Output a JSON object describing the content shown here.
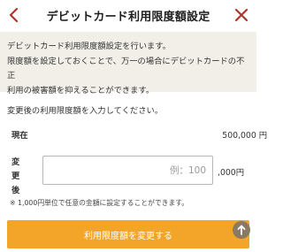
{
  "header": {
    "title": "デビットカード利用限度額設定",
    "back_icon": "chevron-left-icon",
    "close_icon": "close-icon",
    "accent_color": "#b3322b"
  },
  "intro": {
    "line1": "デビットカード利用限度額設定を行います。",
    "line2": "限度額を設定しておくことで、万一の場合にデビットカードの不正",
    "line3": "利用の被害額を抑えることができます。"
  },
  "instruction": "変更後の利用限度額を入力してください。",
  "current": {
    "label": "現在",
    "value": "500,000 円"
  },
  "change": {
    "label": "変更後",
    "placeholder": "例：100",
    "unit": ",000円"
  },
  "note": "※ 1,000円単位で任意の金額に設定することができます。",
  "submit": {
    "label": "利用限度額を変更する",
    "color": "#f2a528"
  },
  "scroll_top_icon": "arrow-up-icon"
}
